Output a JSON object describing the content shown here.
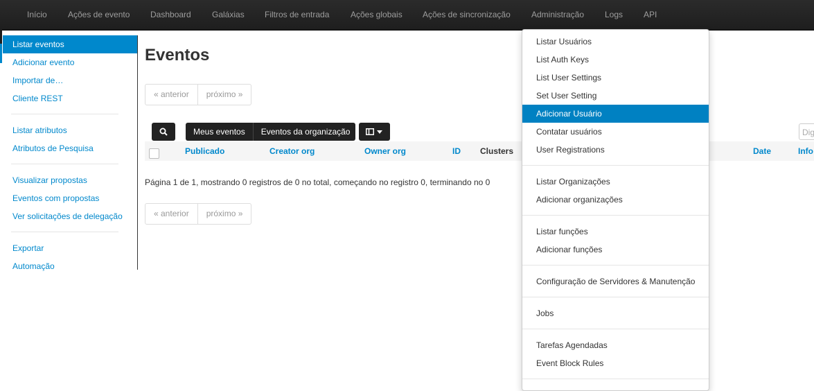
{
  "topnav": {
    "items": [
      "Início",
      "Ações de evento",
      "Dashboard",
      "Galáxias",
      "Filtros de entrada",
      "Ações globais",
      "Ações de sincronização",
      "Administração",
      "Logs",
      "API"
    ]
  },
  "sidebar": {
    "items": [
      "Listar eventos",
      "Adicionar evento",
      "Importar de…",
      "Cliente REST",
      "Listar atributos",
      "Atributos de Pesquisa",
      "Visualizar propostas",
      "Eventos com propostas",
      "Ver solicitações de delegação",
      "Exportar",
      "Automação"
    ],
    "active_index": 0
  },
  "main": {
    "title": "Eventos",
    "pagination": {
      "prev": "« anterior",
      "next": "próximo »"
    },
    "filters": {
      "my_events": "Meus eventos",
      "org_events": "Eventos da organização"
    },
    "search_placeholder": "Dig",
    "columns": [
      "Publicado",
      "Creator org",
      "Owner org",
      "ID",
      "Clusters",
      "Date",
      "Info"
    ],
    "summary": "Página 1 de 1, mostrando 0 registros de 0 no total, começando no registro 0, terminando no 0"
  },
  "dropdown": {
    "items": [
      "Listar Usuários",
      "List Auth Keys",
      "List User Settings",
      "Set User Setting",
      "Adicionar Usuário",
      "Contatar usuários",
      "User Registrations",
      "Listar Organizações",
      "Adicionar organizações",
      "Listar funções",
      "Adicionar funções",
      "Configuração de Servidores & Manutenção",
      "Jobs",
      "Tarefas Agendadas",
      "Event Block Rules"
    ],
    "active_index": 4
  },
  "colors": {
    "accent": "#0088cc",
    "navbar": "#222222"
  },
  "icons": [
    "search-icon",
    "columns-icon",
    "caret-down-icon"
  ]
}
